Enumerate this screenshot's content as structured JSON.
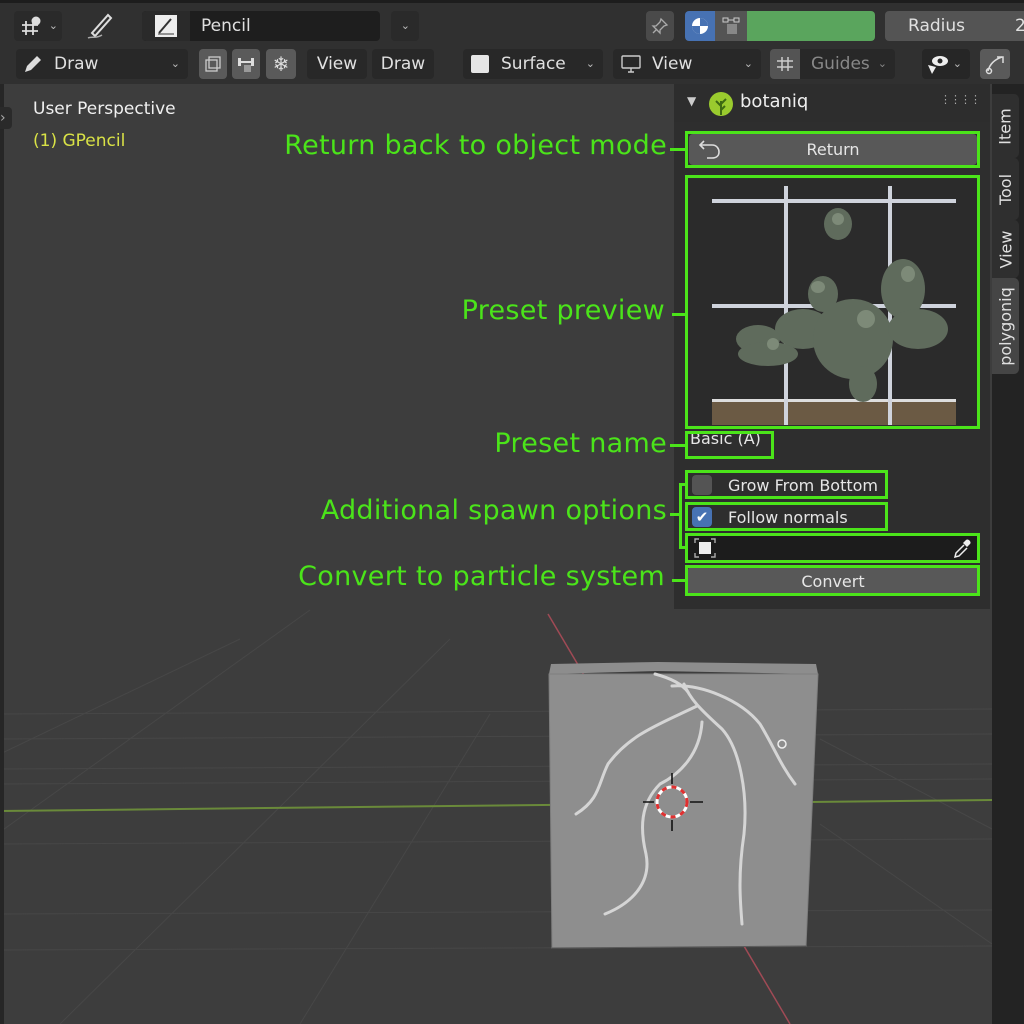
{
  "header": {
    "tool_name": "Pencil",
    "radius_label": "Radius",
    "radius_value_partial": "2",
    "color_swatch": "#5aa55d",
    "accent_blue": "#4772b3"
  },
  "toolbar": {
    "mode_label": "Draw",
    "view_menu": "View",
    "draw_menu": "Draw",
    "placement_label": "Surface",
    "orientation_label": "View",
    "guides_label": "Guides"
  },
  "viewport": {
    "title": "User Perspective",
    "object": "(1) GPencil"
  },
  "sidebar_tabs": [
    {
      "label": "Item",
      "active": false
    },
    {
      "label": "Tool",
      "active": false
    },
    {
      "label": "View",
      "active": false
    },
    {
      "label": "polygoniq",
      "active": true
    }
  ],
  "panel": {
    "title": "botaniq",
    "return_label": "Return",
    "preset_name": "Basic (A)",
    "options": [
      {
        "label": "Grow From Bottom",
        "checked": false
      },
      {
        "label": "Follow normals",
        "checked": true
      }
    ],
    "object_field_value": "",
    "convert_label": "Convert"
  },
  "annotations": {
    "return": "Return back to object mode",
    "preview": "Preset preview",
    "preset_name": "Preset name",
    "spawn_options": "Additional spawn options",
    "convert": "Convert to particle system",
    "color": "#4be41a"
  }
}
